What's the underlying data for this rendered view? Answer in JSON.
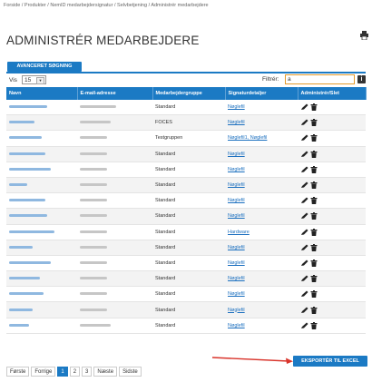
{
  "breadcrumb": "Forside / Produkter / NemID medarbejdersignatur / Selvbetjening / Administrér medarbejdere",
  "page_title": "ADMINISTRÉR MEDARBEJDERE",
  "advanced_search_label": "AVANCERET SØGNING",
  "show": {
    "label": "Vis",
    "value": "15"
  },
  "filter": {
    "label": "Filtrér:",
    "value": "a"
  },
  "columns": [
    "Navn",
    "E-mail-adresse",
    "Medarbejdergruppe",
    "Signaturdetaljer",
    "Administrér/Slet"
  ],
  "rows": [
    {
      "group": "Standard",
      "signature": "Nøglefil"
    },
    {
      "group": "FOCES",
      "signature": "Nøglefil"
    },
    {
      "group": "Testgruppen",
      "signature": "Nøglefil1, Nøglefil"
    },
    {
      "group": "Standard",
      "signature": "Nøglefil"
    },
    {
      "group": "Standard",
      "signature": "Nøglefil"
    },
    {
      "group": "Standard",
      "signature": "Nøglefil"
    },
    {
      "group": "Standard",
      "signature": "Nøglefil"
    },
    {
      "group": "Standard",
      "signature": "Nøglefil"
    },
    {
      "group": "Standard",
      "signature": "Hardware"
    },
    {
      "group": "Standard",
      "signature": "Nøglefil"
    },
    {
      "group": "Standard",
      "signature": "Nøglefil"
    },
    {
      "group": "Standard",
      "signature": "Nøglefil"
    },
    {
      "group": "Standard",
      "signature": "Nøglefil"
    },
    {
      "group": "Standard",
      "signature": "Nøglefil"
    },
    {
      "group": "Standard",
      "signature": "Nøglefil"
    }
  ],
  "export_label": "EKSPORTÉR TIL EXCEL",
  "pager": {
    "first": "Første",
    "prev": "Forrige",
    "pages": [
      "1",
      "2",
      "3"
    ],
    "next": "Næste",
    "last": "Sidste"
  },
  "colors": {
    "primary": "#1b7ac4",
    "arrow": "#d9342b",
    "filter_border": "#e39a2c"
  }
}
